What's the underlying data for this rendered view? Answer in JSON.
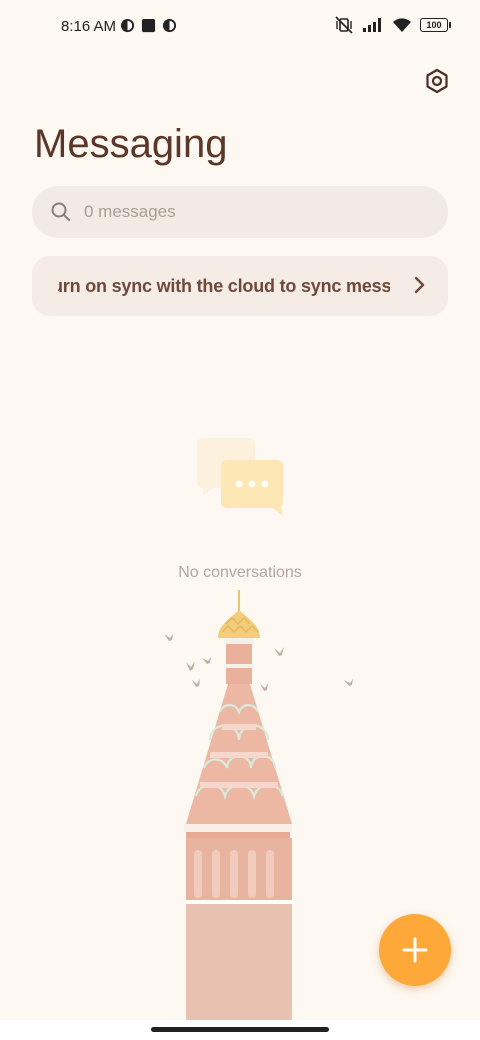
{
  "status_bar": {
    "time": "8:16 AM",
    "battery": "100",
    "icons": [
      "app-notification-icon",
      "square-notification-icon",
      "app-notification-icon",
      "vibrate-muted-icon",
      "signal-icon",
      "wifi-icon",
      "battery-icon"
    ]
  },
  "header": {
    "title": "Messaging",
    "settings_icon": "settings-hexagon-icon"
  },
  "search": {
    "placeholder": "0 messages",
    "icon": "search-icon"
  },
  "sync_banner": {
    "text": "urn on sync with the cloud to sync messag",
    "icon": "chevron-right-icon"
  },
  "empty_state": {
    "label": "No conversations",
    "icon": "chat-bubbles-icon"
  },
  "fab": {
    "icon": "plus-icon"
  },
  "colors": {
    "background": "#fdf8f1",
    "accent": "#ffa83a",
    "title": "#5b3729",
    "search_bg": "#f1ebe4",
    "banner_bg": "#f4ece5"
  }
}
